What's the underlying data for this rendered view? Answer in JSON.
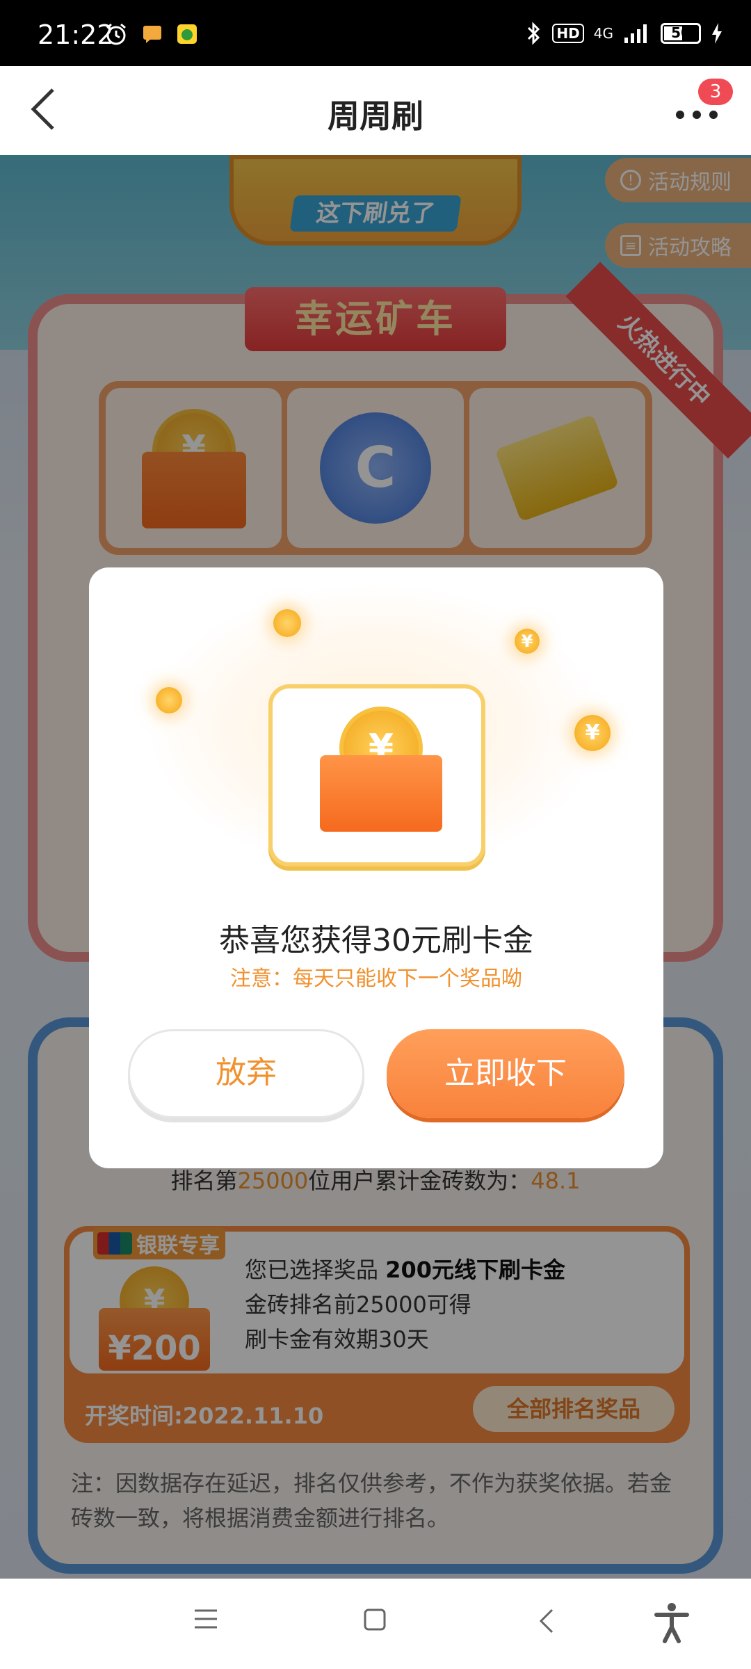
{
  "status_bar": {
    "time": "21:22",
    "battery": "50",
    "signal_label": "4G",
    "hd_label": "HD",
    "icons": [
      "alarm-icon",
      "message-icon",
      "app-icon",
      "bluetooth-icon",
      "hd-icon",
      "signal-icon",
      "battery-icon",
      "charging-icon"
    ]
  },
  "header": {
    "title": "周周刷",
    "notification_count": "3"
  },
  "banner": {
    "subtitle": "这下刷兑了",
    "rules_button": "活动规则",
    "guide_button": "活动攻略"
  },
  "lucky_cart": {
    "title": "幸运矿车",
    "ribbon": "火热进行中",
    "prizes": [
      "coin-gift-box",
      "blue-coin-stack",
      "gold-bars"
    ]
  },
  "dialog": {
    "title": "恭喜您获得30元刷卡金",
    "note": "注意：每天只能收下一个奖品呦",
    "give_up_label": "放弃",
    "accept_label": "立即收下",
    "coin_symbol": "¥"
  },
  "ranking": {
    "line_prefix": "排名第",
    "rank_number": "25000",
    "line_middle": "位用户累计金砖数为：",
    "gold_count": "48.1",
    "prize_card": {
      "tag": "银联专享",
      "amount": "¥200",
      "line1_prefix": "您已选择奖品",
      "line1_bold": "200元线下刷卡金",
      "line2": "金砖排名前25000可得",
      "line3": "刷卡金有效期30天",
      "draw_time": "开奖时间:2022.11.10",
      "all_prizes_button": "全部排名奖品"
    },
    "note": "注：因数据存在延迟，排名仅供参考，不作为获奖依据。若金砖数一致，将根据消费金额进行排名。"
  },
  "colors": {
    "accent_orange": "#f8823c",
    "note_orange": "#f0912e",
    "badge_red": "#f04a55",
    "panel_blue": "#5a98d8",
    "panel_red": "#f08e8e"
  }
}
